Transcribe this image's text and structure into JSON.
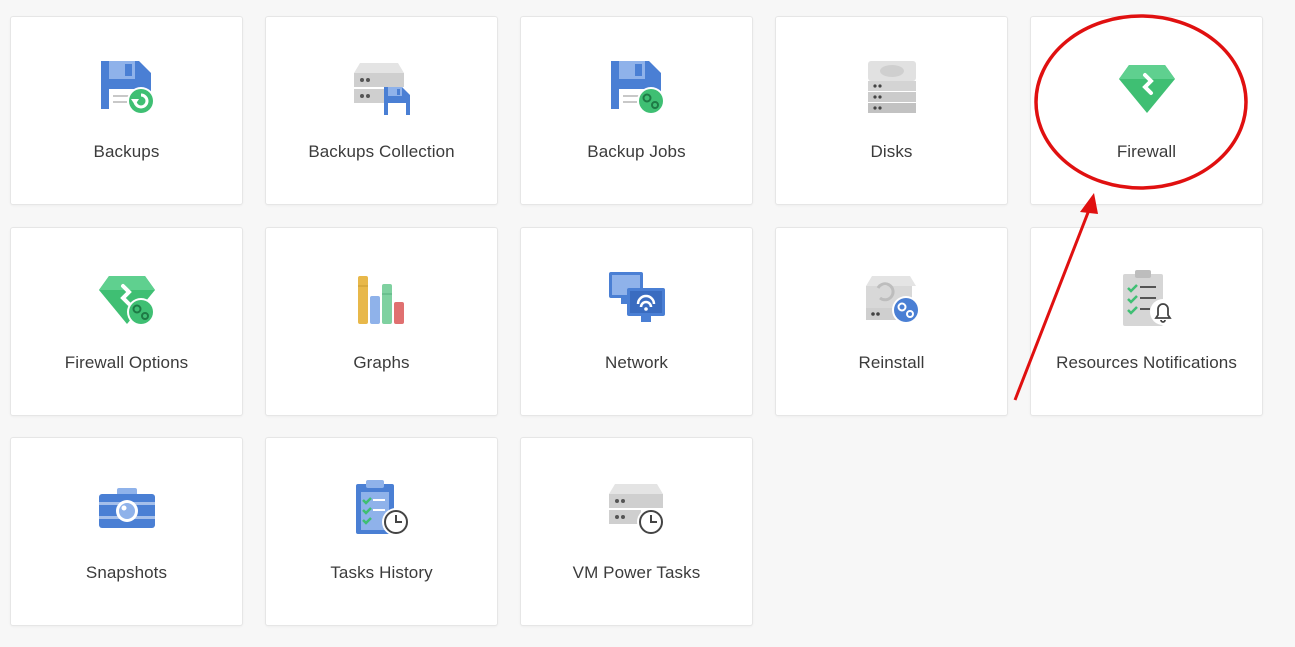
{
  "tiles": [
    {
      "label": "Backups",
      "icon": "backups-icon"
    },
    {
      "label": "Backups Collection",
      "icon": "backups-collection-icon"
    },
    {
      "label": "Backup Jobs",
      "icon": "backup-jobs-icon"
    },
    {
      "label": "Disks",
      "icon": "disks-icon"
    },
    {
      "label": "Firewall",
      "icon": "firewall-icon"
    },
    {
      "label": "Firewall Options",
      "icon": "firewall-options-icon"
    },
    {
      "label": "Graphs",
      "icon": "graphs-icon"
    },
    {
      "label": "Network",
      "icon": "network-icon"
    },
    {
      "label": "Reinstall",
      "icon": "reinstall-icon"
    },
    {
      "label": "Resources Notifications",
      "icon": "resources-notifications-icon"
    },
    {
      "label": "Snapshots",
      "icon": "snapshots-icon"
    },
    {
      "label": "Tasks History",
      "icon": "tasks-history-icon"
    },
    {
      "label": "VM Power Tasks",
      "icon": "vm-power-tasks-icon"
    }
  ],
  "colors": {
    "blue": "#4a7fd4",
    "light_blue": "#8fb2ea",
    "green": "#3fbf73",
    "gray": "#c8c8c8",
    "annotation_red": "#e01010"
  }
}
